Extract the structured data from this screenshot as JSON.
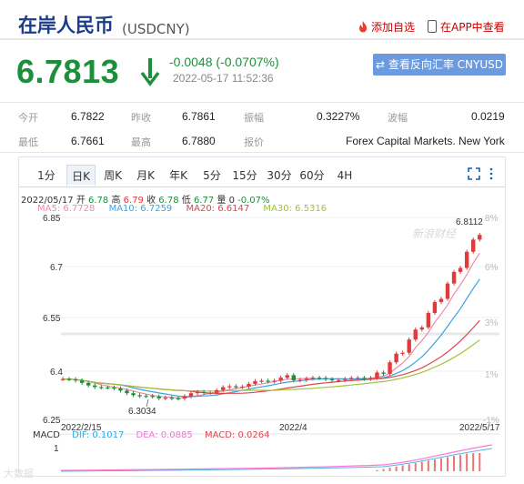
{
  "header": {
    "title": "在岸人民币",
    "symbol": "(USDCNY)",
    "add_watchlist": "添加自选",
    "in_app": "在APP中查看"
  },
  "quote": {
    "price": "6.7813",
    "change": "-0.0048 (-0.0707%)",
    "datetime": "2022-05-17 11:52:36",
    "reverse_button": "⇄ 查看反向汇率 CNYUSD"
  },
  "stats": {
    "row1": [
      {
        "label": "今开",
        "value": "6.7822"
      },
      {
        "label": "昨收",
        "value": "6.7861"
      },
      {
        "label": "振幅",
        "value": "0.3227%"
      },
      {
        "label": "波幅",
        "value": "0.0219"
      }
    ],
    "row2": [
      {
        "label": "最低",
        "value": "6.7661"
      },
      {
        "label": "最高",
        "value": "6.7880"
      },
      {
        "label": "报价",
        "value": "Forex Capital Markets. New York"
      }
    ]
  },
  "chart": {
    "tabs": [
      "1分",
      "日K",
      "周K",
      "月K",
      "年K",
      "5分",
      "15分",
      "30分",
      "60分",
      "4H"
    ],
    "active_tab": "日K",
    "ohlc": {
      "date": "2022/05/17",
      "open_label": "开",
      "open": "6.78",
      "high_label": "高",
      "high": "6.79",
      "close_label": "收",
      "close": "6.78",
      "low_label": "低",
      "low": "6.77",
      "vol_label": "量",
      "vol": "0",
      "pct": "-0.07%"
    },
    "ma": {
      "ma5": "MA5: 6.7728",
      "ma10": "MA10: 6.7259",
      "ma20": "MA20: 6.6147",
      "ma30": "MA30: 6.5316"
    },
    "macd": {
      "label": "MACD",
      "dif": "DIF: 0.1017",
      "dea": "DEA: 0.0885",
      "macd": "MACD: 0.0264"
    },
    "watermark": "新浪财经",
    "colors": {
      "up": "#e03b3b",
      "down": "#1d8f3a",
      "ma5": "#f08aa6",
      "ma10": "#34a6e0",
      "ma20": "#d9484e",
      "ma30": "#a3c23a"
    }
  },
  "chart_data": {
    "type": "candlestick",
    "y_left_ticks": [
      "6.85",
      "6.7",
      "6.55",
      "6.4",
      "6.25"
    ],
    "y_right_ticks": [
      "8%",
      "6%",
      "3%",
      "1%",
      "-1%"
    ],
    "x_labels": [
      "2022/2/15",
      "2022/4",
      "2022/5/17"
    ],
    "ylim": [
      6.25,
      6.85
    ],
    "annotations": {
      "low": "6.3034",
      "high": "6.8112"
    },
    "macd_tick": "1"
  },
  "footer": {
    "watermark_text": "大数据"
  }
}
